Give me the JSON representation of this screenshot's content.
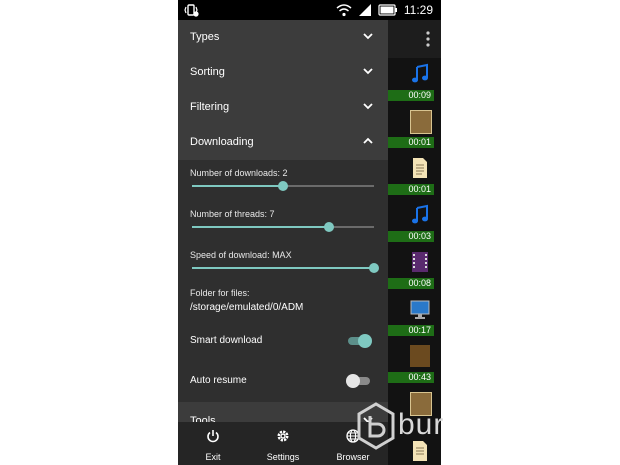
{
  "status_bar": {
    "time": "11:29",
    "icons": [
      "vibrate-icon",
      "wifi-icon",
      "signal-icon",
      "battery-icon"
    ]
  },
  "drawer": {
    "sections": [
      {
        "label": "Types",
        "state": "collapsed"
      },
      {
        "label": "Sorting",
        "state": "collapsed"
      },
      {
        "label": "Filtering",
        "state": "collapsed"
      },
      {
        "label": "Downloading",
        "state": "expanded"
      }
    ],
    "downloading": {
      "number_of_downloads_label": "Number of downloads: 2",
      "number_of_downloads_fraction": 0.5,
      "number_of_threads_label": "Number of threads: 7",
      "number_of_threads_fraction": 0.75,
      "speed_label": "Speed of download: MAX",
      "speed_fraction": 1.0,
      "folder_label": "Folder for files:",
      "folder_path": "/storage/emulated/0/ADM",
      "smart_download_label": "Smart download",
      "smart_download_on": true,
      "auto_resume_label": "Auto resume",
      "auto_resume_on": false
    },
    "tools_label": "Tools",
    "bottom_buttons": [
      {
        "label": "Exit",
        "icon": "power-icon"
      },
      {
        "label": "Settings",
        "icon": "gear-icon"
      },
      {
        "label": "Browser",
        "icon": "globe-icon"
      }
    ]
  },
  "background_list": {
    "times": [
      "00:09",
      "00:01",
      "00:01",
      "00:03",
      "00:08",
      "00:17",
      "00:43"
    ],
    "icons": [
      "music-note-icon",
      "image-icon",
      "document-icon",
      "document-icon",
      "music-note-icon",
      "video-icon",
      "monitor-icon",
      "archive-icon",
      "image-icon",
      "document-icon"
    ]
  },
  "watermark": {
    "text": "bur"
  },
  "colors": {
    "accent": "#7fc9c1",
    "drawer_bg": "#3c3c3c",
    "panel_bg": "#2f2f2f",
    "progress_green": "#1e6d16",
    "icon_blue": "#1a73e8"
  }
}
